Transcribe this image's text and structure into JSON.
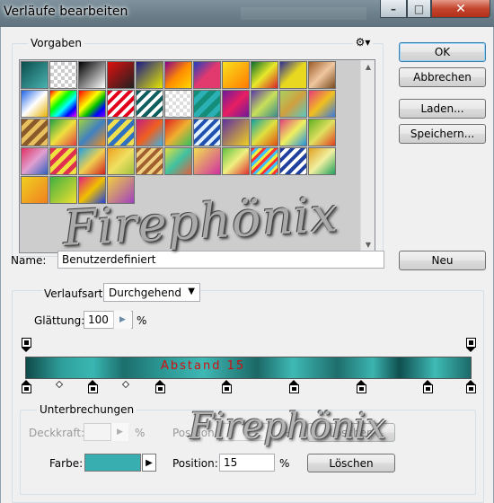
{
  "window": {
    "title": "Verläufe bearbeiten",
    "controls": {
      "minimize": "–",
      "maximize": "□",
      "close": "✕"
    }
  },
  "presets": {
    "legend": "Vorgaben",
    "menu_icon": "gear-icon",
    "swatches": [
      "linear-gradient(135deg,#0a4d4d,#4ab3b0)",
      "repeating-conic-gradient(#ccc 0 25%,#fff 0 50%) 0 0/8px 8px",
      "linear-gradient(135deg,#000,#fff)",
      "linear-gradient(135deg,#e01010,#202020)",
      "linear-gradient(135deg,#1a1a8c,#e6e600)",
      "linear-gradient(135deg,#8b008b,#ff8c00,#ffd700)",
      "linear-gradient(135deg,#1f3fbf,#e23a6e,#e23a6e)",
      "linear-gradient(135deg,#f9e11d,#ff7a00)",
      "linear-gradient(135deg,#0b6d2b,#e8e82a,#d5242b)",
      "linear-gradient(135deg,#2d2d96,#e8d820,#e8d820)",
      "linear-gradient(135deg,#9b5b2a,#f0c8a0,#7a4a20)",
      "linear-gradient(135deg,#1e64e6,#fff 50%,#e6b000)",
      "linear-gradient(135deg,#ff0000,#ffff00,#00ff00,#00ffff,#0000ff,#ff00ff)",
      "linear-gradient(135deg,#ff0000,#ff8000,#ffff00,#00c000,#0000ff,#8000ff)",
      "repeating-linear-gradient(135deg,#e3001b 0 4px,#ffffff 4px 8px)",
      "repeating-linear-gradient(135deg,#0e5e5e 0 4px,#ffffff 4px 8px)",
      "repeating-conic-gradient(#ddd 0 25%,#fff 0 50%) 0 0/8px 8px",
      "repeating-linear-gradient(135deg,#148e7a 0 6px,#2ab0b5 6px 12px)",
      "linear-gradient(135deg,#6a1b9a,#e91e63,#6a1b9a)",
      "linear-gradient(135deg,#5b3aa8,#c8e05a,#3a8a8a)",
      "linear-gradient(135deg,#a8d060,#d0a040,#5ac8c0)",
      "linear-gradient(135deg,#e83a7a,#f0c020,#3a78e0)",
      "repeating-linear-gradient(135deg,#8a5a2a 0 5px,#e8c060 5px 10px)",
      "linear-gradient(135deg,#20a040,#f0e040,#e04040)",
      "linear-gradient(135deg,#a0d040,#4080c0,#f09020)",
      "repeating-linear-gradient(135deg,#3070c0 0 5px,#f0e050 5px 10px)",
      "linear-gradient(135deg,#c02080,#f06020,#40b0e0)",
      "linear-gradient(135deg,#e02020,#f0b030,#30c060)",
      "repeating-linear-gradient(135deg,#2050b0 0 4px,#e0f0ff 4px 8px)",
      "linear-gradient(135deg,#6030a0,#f0d020)",
      "linear-gradient(135deg,#10a0a0,#e0e040,#e05010)",
      "linear-gradient(135deg,#e0407a,#f0f060,#2090e0)",
      "linear-gradient(135deg,#60b020,#e0e060,#e04020)",
      "linear-gradient(135deg,#e03060,#e0a0d0,#3060c0)",
      "repeating-linear-gradient(135deg,#e03050 0 5px,#f0e040 5px 10px)",
      "linear-gradient(135deg,#20a0e0,#f0d050,#d02020)",
      "linear-gradient(135deg,#f0a020,#f0e060,#a0c040)",
      "repeating-linear-gradient(135deg,#a06030 0 4px,#f0d080 4px 8px)",
      "linear-gradient(135deg,#e0e040,#40c0a0,#e06040)",
      "linear-gradient(135deg,#f0e050,#d030a0)",
      "linear-gradient(135deg,#60c040,#f0f080,#e03030)",
      "repeating-linear-gradient(135deg,#ff3030 0 3px,#40c0ff 3px 6px,#f0f040 6px 9px)",
      "repeating-linear-gradient(135deg,#2040a0 0 4px,#ffffff 4px 8px)",
      "linear-gradient(135deg,#e0a020,#f0f0a0,#20a060)",
      "linear-gradient(135deg,#f0d020,#f08020)",
      "linear-gradient(135deg,#40b040,#f0e030)",
      "linear-gradient(135deg,#e02080,#f0c000,#2040e0)",
      "linear-gradient(135deg,#f0d040,#a040c0)"
    ]
  },
  "buttons": {
    "ok": "OK",
    "cancel": "Abbrechen",
    "load": "Laden...",
    "save": "Speichern...",
    "new": "Neu",
    "delete_opacity": "Löschen",
    "delete_color": "Löschen"
  },
  "name_row": {
    "label": "Name:",
    "value": "Benutzerdefiniert"
  },
  "gradient": {
    "type_label": "Verlaufsart:",
    "type_value": "Durchgehend",
    "smoothness_label": "Glättung:",
    "smoothness_value": "100",
    "smoothness_unit": "%",
    "bar_text": "Abstand 15"
  },
  "stops": {
    "legend": "Unterbrechungen",
    "opacity_label": "Deckkraft:",
    "opacity_value": "",
    "opacity_unit": "%",
    "opacity_position_label": "Position:",
    "opacity_position_value": "",
    "opacity_position_unit": "%",
    "color_label": "Farbe:",
    "color_value": "#39aeb0",
    "position_label": "Position:",
    "position_value": "15",
    "position_unit": "%"
  },
  "watermark": {
    "text1": "Firephönix",
    "text2": "Firephönix"
  }
}
